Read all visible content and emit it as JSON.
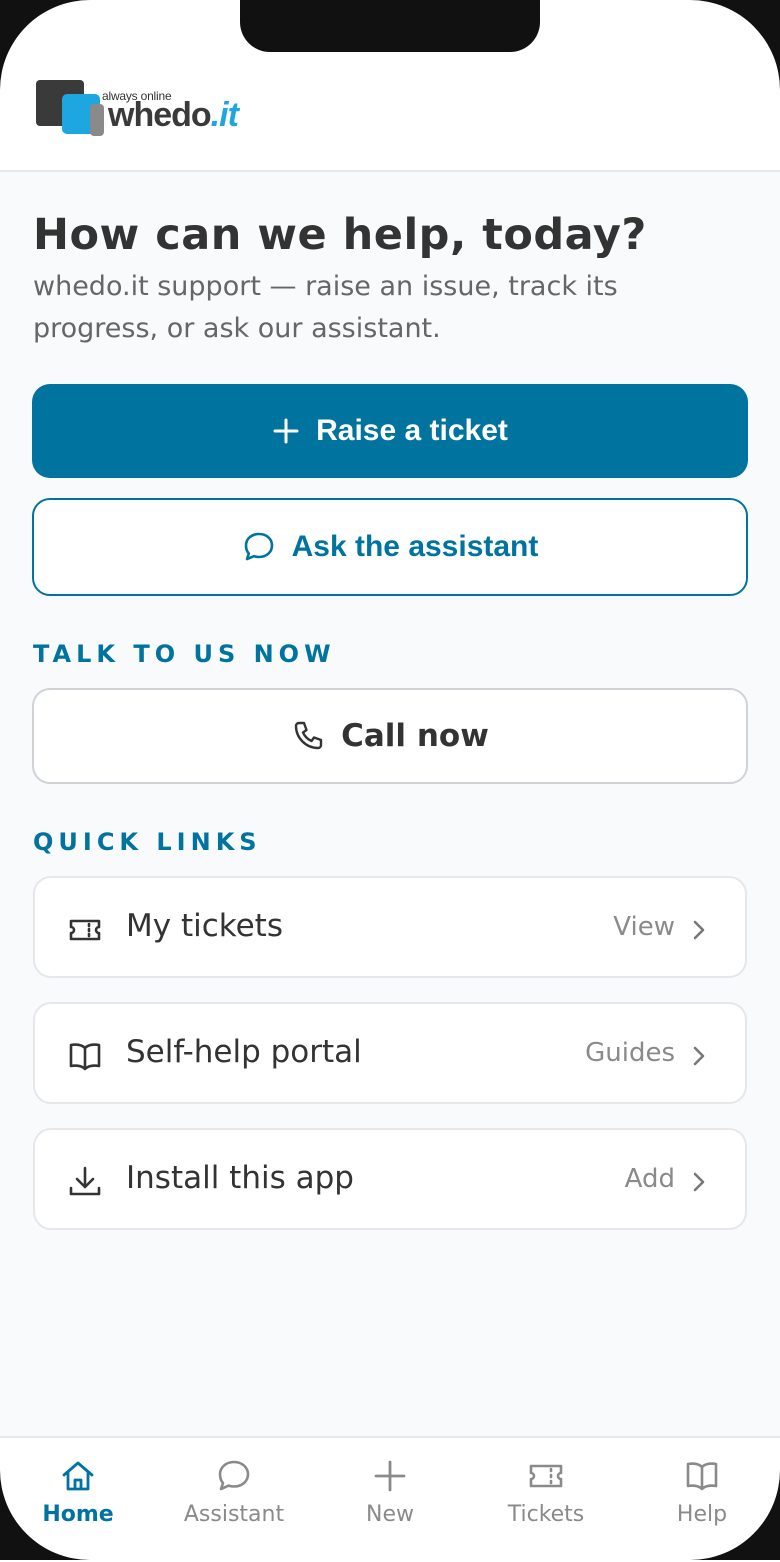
{
  "header": {
    "logo_tagline": "always online",
    "logo_brand": "whedo",
    "logo_brand_suffix": ".it"
  },
  "hero": {
    "title": "How can we help, today?",
    "subtitle": "whedo.it support — raise an issue, track its progress, or ask our assistant."
  },
  "actions": {
    "raise_ticket": "Raise a ticket",
    "ask_assistant": "Ask the assistant"
  },
  "talk": {
    "section_title": "TALK TO US NOW",
    "call_label": "Call now"
  },
  "quick_links": {
    "section_title": "QUICK LINKS",
    "items": [
      {
        "title": "My tickets",
        "action": "View",
        "icon": "ticket-icon"
      },
      {
        "title": "Self-help portal",
        "action": "Guides",
        "icon": "book-icon"
      },
      {
        "title": "Install this app",
        "action": "Add",
        "icon": "download-icon"
      }
    ]
  },
  "bottom_nav": {
    "items": [
      {
        "label": "Home",
        "icon": "home-icon",
        "active": true
      },
      {
        "label": "Assistant",
        "icon": "chat-icon",
        "active": false
      },
      {
        "label": "New",
        "icon": "plus-icon",
        "active": false
      },
      {
        "label": "Tickets",
        "icon": "ticket-icon",
        "active": false
      },
      {
        "label": "Help",
        "icon": "book-icon",
        "active": false
      }
    ]
  },
  "colors": {
    "accent": "#00739e",
    "brand_blue": "#1ea6e0",
    "text": "#333333",
    "muted": "#8a8a8a",
    "background": "#f8fafc"
  }
}
